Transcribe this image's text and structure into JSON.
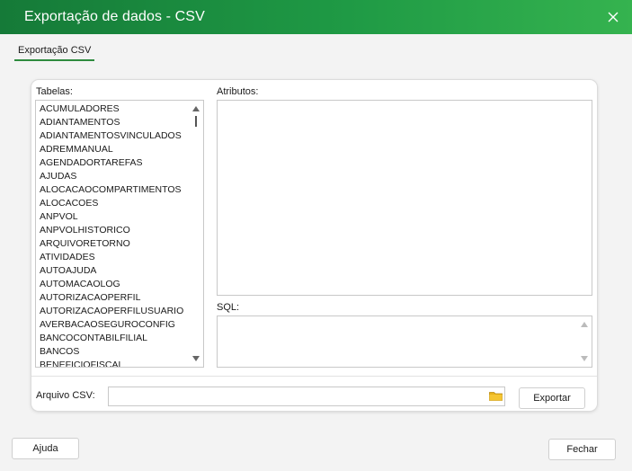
{
  "window": {
    "title": "Exportação de dados - CSV"
  },
  "tabs": [
    {
      "label": "Exportação CSV"
    }
  ],
  "tables": {
    "label": "Tabelas:",
    "items": [
      "ACUMULADORES",
      "ADIANTAMENTOS",
      "ADIANTAMENTOSVINCULADOS",
      "ADREMMANUAL",
      "AGENDADORTAREFAS",
      "AJUDAS",
      "ALOCACAOCOMPARTIMENTOS",
      "ALOCACOES",
      "ANPVOL",
      "ANPVOLHISTORICO",
      "ARQUIVORETORNO",
      "ATIVIDADES",
      "AUTOAJUDA",
      "AUTOMACAOLOG",
      "AUTORIZACAOPERFIL",
      "AUTORIZACAOPERFILUSUARIO",
      "AVERBACAOSEGUROCONFIG",
      "BANCOCONTABILFILIAL",
      "BANCOS",
      "BENEFICIOFISCAL"
    ]
  },
  "attributes": {
    "label": "Atributos:"
  },
  "sql": {
    "label": "SQL:"
  },
  "csv": {
    "label": "Arquivo CSV:",
    "value": ""
  },
  "buttons": {
    "export": "Exportar",
    "help": "Ajuda",
    "close": "Fechar"
  },
  "icons": {
    "close": "close-icon",
    "folder": "folder-icon"
  },
  "colors": {
    "title_start": "#157a38",
    "title_end": "#35b34f",
    "tab_underline": "#2e8b3e",
    "folder": "#e8b21a"
  }
}
